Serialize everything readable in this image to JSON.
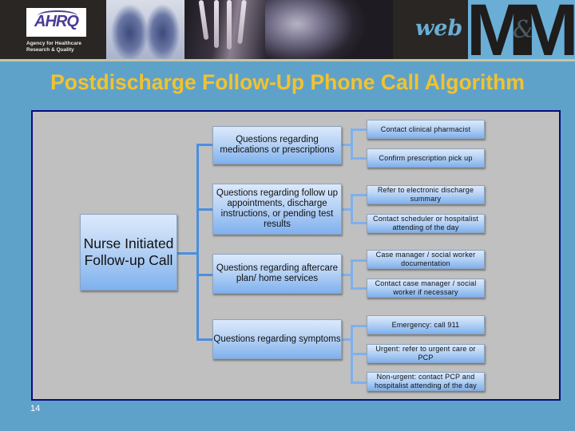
{
  "header": {
    "logo": {
      "name": "AHRQ",
      "agency": "Agency for Healthcare\nResearch & Quality"
    },
    "brand": {
      "web": "web",
      "m1": "M",
      "amp": "&",
      "m2": "M"
    },
    "images": [
      "chest-xray",
      "hand-xray",
      "skull-xray"
    ]
  },
  "title": "Postdischarge Follow-Up Phone Call Algorithm",
  "diagram": {
    "root": "Nurse Initiated Follow-up Call",
    "branches": [
      {
        "question": "Questions regarding medications or prescriptions",
        "actions": [
          "Contact clinical pharmacist",
          "Confirm prescription pick up"
        ]
      },
      {
        "question": "Questions regarding follow up appointments, discharge instructions, or pending test results",
        "actions": [
          "Refer to electronic discharge summary",
          "Contact scheduler or hospitalist attending of the day"
        ]
      },
      {
        "question": "Questions regarding aftercare plan/ home services",
        "actions": [
          "Case manager / social worker documentation",
          "Contact case manager / social worker if necessary"
        ]
      },
      {
        "question": "Questions regarding symptoms",
        "actions": [
          "Emergency: call 911",
          "Urgent: refer to  urgent care or PCP",
          "Non-urgent: contact PCP and hospitalist attending of the day"
        ]
      }
    ]
  },
  "slide_number": "14",
  "colors": {
    "background": "#5FA2C9",
    "title": "#F2C230",
    "panel": "#C0C0C0",
    "panel_border": "#0a0a80",
    "connector": "#4a8fe0"
  }
}
